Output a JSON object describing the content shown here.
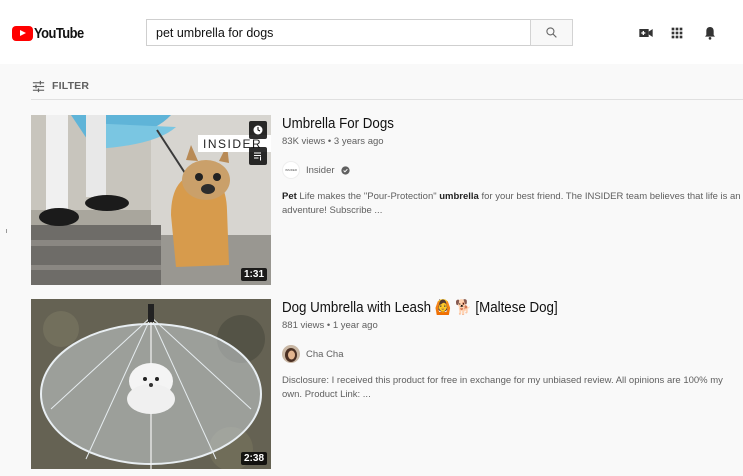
{
  "header": {
    "logo_text": "YouTube",
    "search_value": "pet umbrella for dogs",
    "icons": [
      "search-icon",
      "create-video-icon",
      "apps-grid-icon",
      "notifications-bell-icon"
    ]
  },
  "filter": {
    "label": "FILTER"
  },
  "results": [
    {
      "title": "Umbrella For Dogs",
      "meta": "83K views • 3 years ago",
      "channel": "Insider",
      "channel_avatar_text": "INSIDER",
      "verified": true,
      "desc_parts": [
        "Pet",
        " Life makes the \"Pour-Protection\" ",
        "umbrella",
        " for your best friend. The INSIDER team believes that life is an adventure! Subscribe ..."
      ],
      "duration": "1:31",
      "thumb_overlay": "INSIDER"
    },
    {
      "title": "Dog Umbrella with Leash 🙆 🐕 [Maltese Dog]",
      "meta": "881 views • 1 year ago",
      "channel": "Cha Cha",
      "desc": "Disclosure: I received this product for free in exchange for my unbiased review. All opinions are 100% my own. Product Link: ...",
      "duration": "2:38"
    }
  ],
  "colors": {
    "brand_red": "#ff0000",
    "page_bg": "#f9f9f9",
    "title_text": "#111111",
    "meta_text": "#606060"
  }
}
